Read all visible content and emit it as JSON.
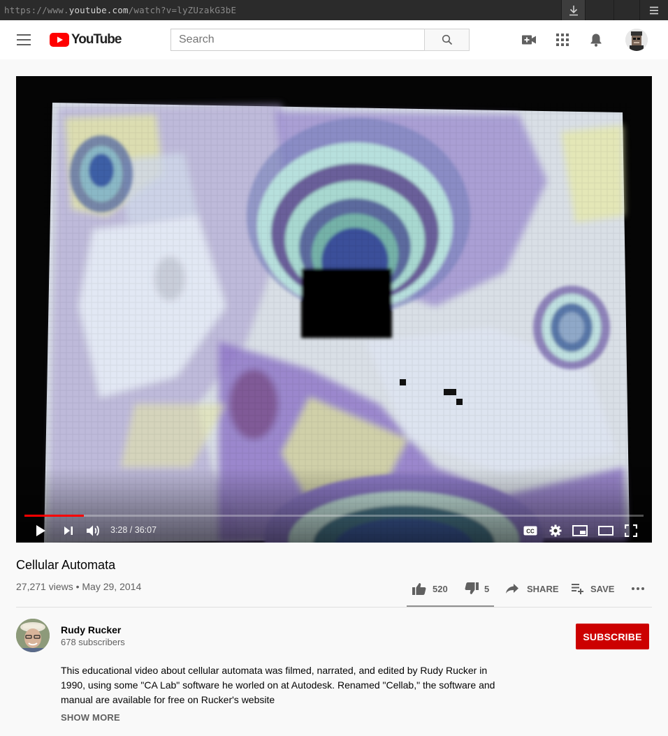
{
  "browser": {
    "url_prefix": "https://www.",
    "url_domain": "youtube.com",
    "url_path": "/watch?v=lyZUzakG3bE"
  },
  "masthead": {
    "logo_text": "YouTube",
    "search_placeholder": "Search"
  },
  "player": {
    "time": "3:28 / 36:07",
    "progress_fraction": 0.096
  },
  "video": {
    "title": "Cellular Automata",
    "views_date": "27,271 views • May 29, 2014",
    "likes": "520",
    "dislikes": "5",
    "share_label": "SHARE",
    "save_label": "SAVE"
  },
  "channel": {
    "name": "Rudy Rucker",
    "subscribers": "678 subscribers",
    "subscribe_label": "SUBSCRIBE"
  },
  "description": {
    "text": "This educational video about cellular automata was filmed, narrated, and edited by Rudy Rucker in 1990, using some \"CA Lab\" software he worled on at Autodesk. Renamed \"Cellab,\" the software and manual are available for free on Rucker's website",
    "show_more": "SHOW MORE"
  },
  "colors": {
    "brand_red": "#ff0000",
    "subscribe_red": "#cc0000",
    "text_secondary": "#606060"
  }
}
